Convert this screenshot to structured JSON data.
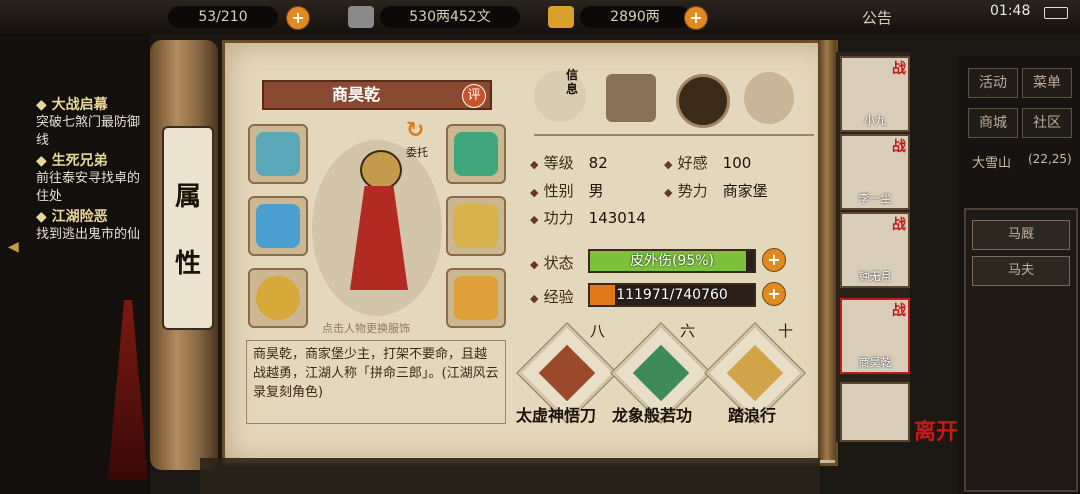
{
  "topbar": {
    "bag": "53/210",
    "money": "530两452文",
    "gold": "2890两",
    "notice": "公告",
    "time": "01:48"
  },
  "quests": [
    {
      "title": "大战启幕",
      "desc": "突破七煞门最防御线"
    },
    {
      "title": "生死兄弟",
      "desc": "前往泰安寻找卓的住处"
    },
    {
      "title": "江湖险恶",
      "desc": "找到逃出鬼市的仙"
    }
  ],
  "attr_tab": [
    "属",
    "性"
  ],
  "character": {
    "name": "商昊乾",
    "rate_badge": "评",
    "entrust": "委托",
    "hint": "点击人物更换服饰",
    "bio": "商昊乾，商家堡少主，打架不要命，且越战越勇，江湖人称「拼命三郎」。(江湖风云录复刻角色)"
  },
  "tabs": [
    "信息"
  ],
  "stats": {
    "level_label": "等级",
    "level": "82",
    "favor_label": "好感",
    "favor": "100",
    "gender_label": "性别",
    "gender": "男",
    "faction_label": "势力",
    "faction": "商家堡",
    "power_label": "功力",
    "power": "143014",
    "status_label": "状态",
    "status": "皮外伤(95%)",
    "status_ratio": 0.95,
    "exp_label": "经验",
    "exp": "111971/740760",
    "exp_ratio": 0.151
  },
  "skills": [
    {
      "level": "八",
      "name": "太虚神悟刀"
    },
    {
      "level": "六",
      "name": "龙象般若功"
    },
    {
      "level": "十",
      "name": "踏浪行"
    }
  ],
  "roster": [
    {
      "name": "小九",
      "battle": "战"
    },
    {
      "name": "李一尘",
      "battle": "战"
    },
    {
      "name": "钟无月",
      "battle": "战"
    },
    {
      "name": "商昊乾",
      "battle": "战"
    },
    {
      "name": "",
      "battle": ""
    }
  ],
  "leave": "离开",
  "menu": {
    "buttons": [
      "活动",
      "菜单",
      "商城",
      "社区"
    ],
    "location": "大雪山",
    "coords": "(22,25)",
    "list": [
      "马厩",
      "马夫"
    ]
  },
  "colors": {
    "status_bar": "#7bc23a",
    "exp_bar": "#e07a18",
    "accent": "#e08a22"
  }
}
